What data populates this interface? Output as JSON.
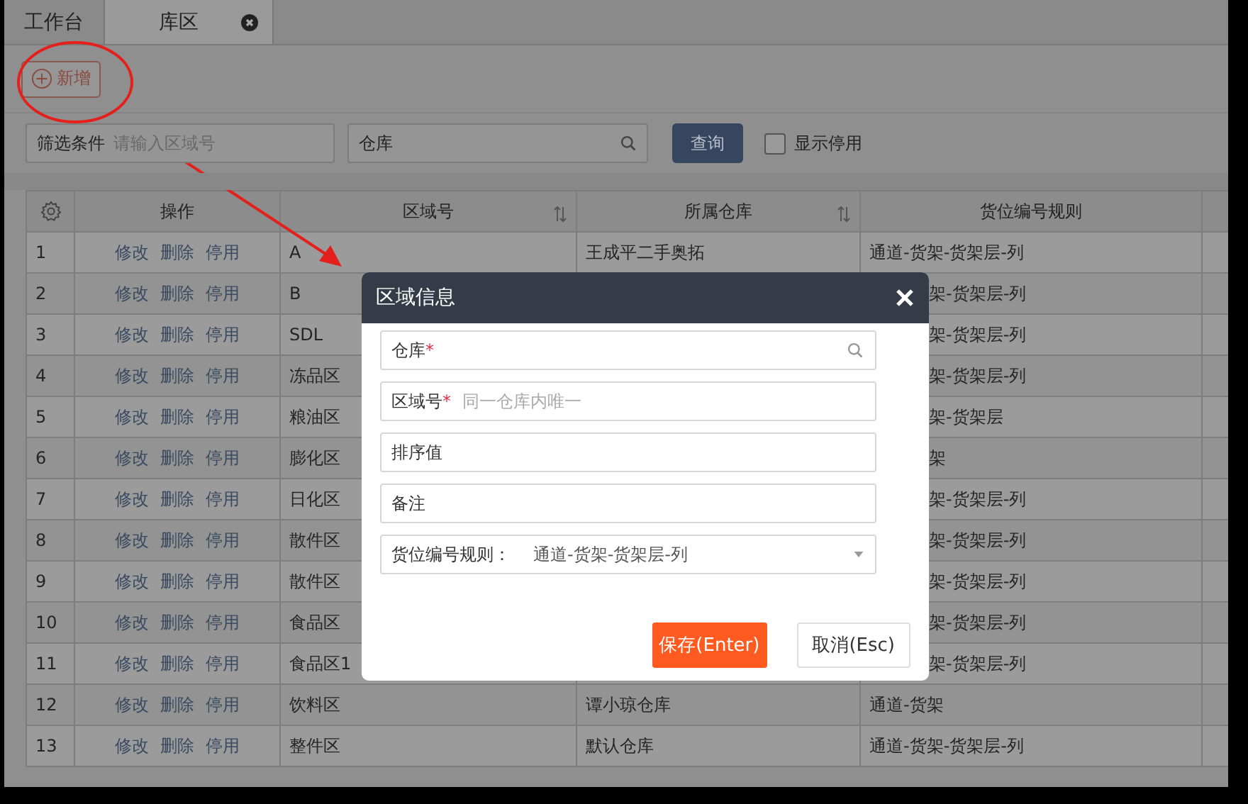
{
  "tabs": [
    {
      "label": "工作台",
      "selected": false,
      "closable": false
    },
    {
      "label": "库区",
      "selected": true,
      "closable": true
    }
  ],
  "toolbar": {
    "add_button": "新增"
  },
  "filters": {
    "condition_label": "筛选条件",
    "condition_placeholder": "请输入区域号",
    "warehouse_placeholder": "仓库",
    "query_button": "查询",
    "show_disabled": {
      "label": "显示停用",
      "checked": false
    }
  },
  "table": {
    "columns": [
      {
        "label": "操作",
        "sortable": false
      },
      {
        "label": "区域号",
        "sortable": true
      },
      {
        "label": "所属仓库",
        "sortable": true
      },
      {
        "label": "货位编号规则",
        "sortable": false
      }
    ],
    "rows": [
      {
        "index": "1",
        "actions": [
          "修改",
          "删除",
          "停用"
        ],
        "zone": "A",
        "warehouse": "王成平二手奥拓",
        "rule": "通道-货架-货架层-列"
      },
      {
        "index": "2",
        "actions": [
          "修改",
          "删除",
          "停用"
        ],
        "zone": "B",
        "rule": "架-货架层-列"
      },
      {
        "index": "3",
        "actions": [
          "修改",
          "删除",
          "停用"
        ],
        "zone": "SDL",
        "rule": "架-货架层-列"
      },
      {
        "index": "4",
        "actions": [
          "修改",
          "删除",
          "停用"
        ],
        "zone": "冻品区",
        "rule": "架-货架层-列"
      },
      {
        "index": "5",
        "actions": [
          "修改",
          "删除",
          "停用"
        ],
        "zone": "粮油区",
        "rule": "架-货架层"
      },
      {
        "index": "6",
        "actions": [
          "修改",
          "删除",
          "停用"
        ],
        "zone": "膨化区",
        "rule": "架"
      },
      {
        "index": "7",
        "actions": [
          "修改",
          "删除",
          "停用"
        ],
        "zone": "日化区",
        "rule": "架-货架层-列"
      },
      {
        "index": "8",
        "actions": [
          "修改",
          "删除",
          "停用"
        ],
        "zone": "散件区",
        "rule": "架-货架层-列"
      },
      {
        "index": "9",
        "actions": [
          "修改",
          "删除",
          "停用"
        ],
        "zone": "散件区",
        "rule": "架-货架层-列"
      },
      {
        "index": "10",
        "actions": [
          "修改",
          "删除",
          "停用"
        ],
        "zone": "食品区",
        "rule": "架-货架层-列"
      },
      {
        "index": "11",
        "actions": [
          "修改",
          "删除",
          "停用"
        ],
        "zone": "食品区1",
        "rule": "架-货架层-列"
      },
      {
        "index": "12",
        "actions": [
          "修改",
          "删除",
          "停用"
        ],
        "zone": "饮料区",
        "warehouse": "谭小琼仓库",
        "rule": "通道-货架"
      },
      {
        "index": "13",
        "actions": [
          "修改",
          "删除",
          "停用"
        ],
        "zone": "整件区",
        "warehouse": "默认仓库",
        "rule": "通道-货架-货架层-列"
      }
    ]
  },
  "dialog": {
    "title": "区域信息",
    "fields": [
      {
        "kind": "search",
        "label": "仓库",
        "required": true,
        "required_mark": "*"
      },
      {
        "kind": "text",
        "label": "区域号",
        "required": true,
        "required_mark": "*",
        "placeholder": "同一仓库内唯一"
      },
      {
        "kind": "text",
        "label": "排序值",
        "required": false
      },
      {
        "kind": "text",
        "label": "备注",
        "required": false
      },
      {
        "kind": "select",
        "label": "货位编号规则：",
        "value": "通道-货架-货架层-列"
      }
    ],
    "save_button": "保存(Enter)",
    "cancel_button": "取消(Esc)"
  }
}
